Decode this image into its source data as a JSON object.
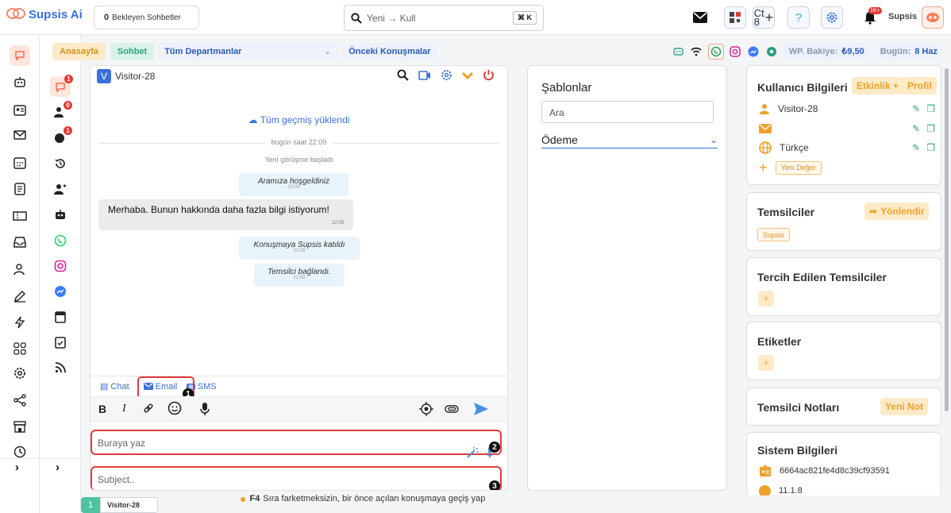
{
  "app": {
    "name": "Supsis Ai"
  },
  "topbar": {
    "pending_count": "0",
    "pending_label": "Bekleyen Sohbetler",
    "search_text": "Yeni → Kull",
    "shortcut": "⌘ K",
    "ct_label": "Ct",
    "ct_count": "8",
    "notification_badge": "1K+",
    "user_name": "Supsis"
  },
  "nav": {
    "home": "Anasayfa",
    "chat": "Sohbet",
    "departments": "Tüm Departmanlar",
    "previous": "Önceki Konuşmalar",
    "balance_label": "WP. Bakiye:",
    "balance_value": "₺9,50",
    "today_label": "Bugün:",
    "today_value": "8 Haz"
  },
  "rail": {
    "badges": {
      "chats": "1",
      "visitors": "0",
      "global": "1"
    }
  },
  "chat": {
    "visitor_initial": "V",
    "visitor_name": "Visitor-28",
    "history_loaded": "Tüm geçmiş yüklendi",
    "date_divider": "bugün saat 22:09",
    "started": "Yeni görüşme başladı",
    "messages": [
      {
        "kind": "system",
        "text": "Aramıza hoşgeldiniz",
        "time": "22:09"
      },
      {
        "kind": "user",
        "text": "Merhaba. Bunun hakkında daha fazla bilgi istiyorum!",
        "time": "22:09"
      },
      {
        "kind": "system",
        "text": "Konuşmaya Supsis katıldı",
        "time": "22:09"
      },
      {
        "kind": "system",
        "text": "Temsilci bağlandı.",
        "time": "22:09"
      }
    ],
    "tabs": {
      "chat": "Chat",
      "email": "Email",
      "sms": "SMS"
    },
    "format": {
      "bold": "B",
      "italic": "I"
    },
    "message_placeholder": "Buraya yaz",
    "subject_placeholder": "Subject..",
    "callouts": [
      "1",
      "2",
      "3"
    ]
  },
  "footer": {
    "hint_key": "F4",
    "hint_text": "Sıra farketmeksizin, bir önce açılan konuşmaya geçiş yap",
    "open_tab_number": "1",
    "open_tab_name": "Visitor-28"
  },
  "templates": {
    "title": "Şablonlar",
    "search_placeholder": "Ara",
    "selected": "Ödeme"
  },
  "user_info": {
    "title": "Kullanıcı Bilgileri",
    "activity_btn": "Etkinlik +",
    "profile_btn": "Profil",
    "name": "Visitor-28",
    "email": "",
    "language": "Türkçe",
    "new_value": "Yeni Değer"
  },
  "agents": {
    "title": "Temsilciler",
    "redirect_btn": "Yönlendir",
    "tag": "Supsis"
  },
  "preferred": {
    "title": "Tercih Edilen Temsilciler"
  },
  "labels": {
    "title": "Etiketler"
  },
  "notes": {
    "title": "Temsilci Notları",
    "new_btn": "Yeni Not"
  },
  "system_info": {
    "title": "Sistem Bilgileri",
    "id": "6664ac821fe4d8c39cf93591",
    "version": "11.1.8"
  },
  "colors": {
    "brand": "#3b6fd9",
    "accent": "#f0a02a",
    "danger": "#e03c3c",
    "success": "#31a37d"
  }
}
